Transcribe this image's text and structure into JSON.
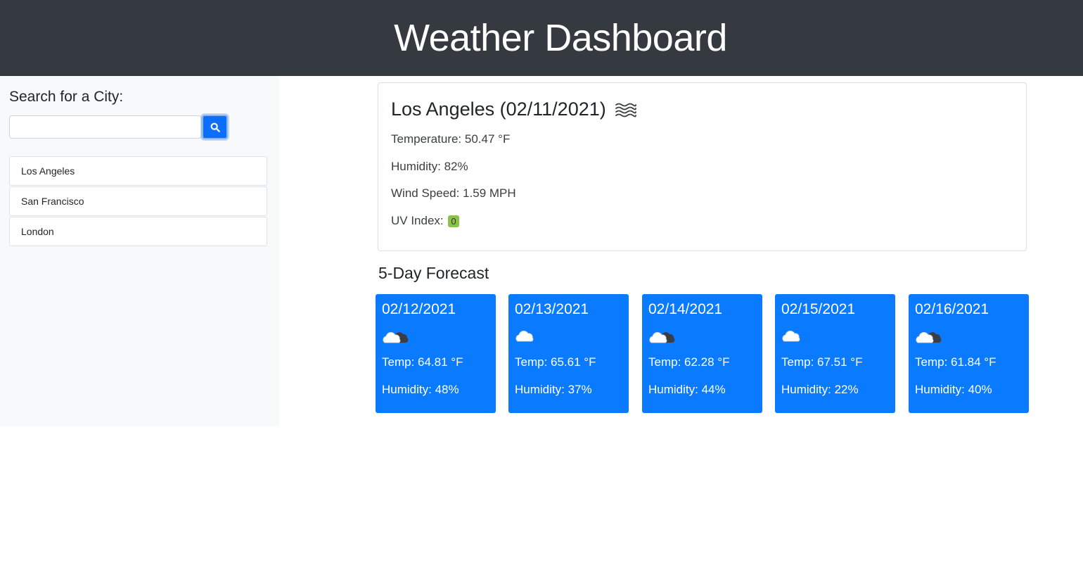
{
  "header": {
    "title": "Weather Dashboard"
  },
  "sidebar": {
    "search_label": "Search for a City:",
    "search_value": "",
    "search_placeholder": "",
    "search_button_icon": "search-icon",
    "history": [
      "Los Angeles",
      "San Francisco",
      "London"
    ]
  },
  "current": {
    "title": "Los Angeles (02/11/2021)",
    "icon": "mist-icon",
    "temperature": "Temperature: 50.47 °F",
    "humidity": "Humidity: 82%",
    "wind": "Wind Speed: 1.59 MPH",
    "uv_label": "UV Index:",
    "uv_value": "0",
    "uv_color": "#8bc34a"
  },
  "forecast": {
    "title": "5-Day Forecast",
    "card_color": "#0a7bff",
    "days": [
      {
        "date": "02/12/2021",
        "icon": "broken-clouds-icon",
        "temp": "Temp: 64.81 °F",
        "humidity": "Humidity: 48%"
      },
      {
        "date": "02/13/2021",
        "icon": "cloud-icon",
        "temp": "Temp: 65.61 °F",
        "humidity": "Humidity: 37%"
      },
      {
        "date": "02/14/2021",
        "icon": "broken-clouds-icon",
        "temp": "Temp: 62.28 °F",
        "humidity": "Humidity: 44%"
      },
      {
        "date": "02/15/2021",
        "icon": "cloud-icon",
        "temp": "Temp: 67.51 °F",
        "humidity": "Humidity: 22%"
      },
      {
        "date": "02/16/2021",
        "icon": "broken-clouds-icon",
        "temp": "Temp: 61.84 °F",
        "humidity": "Humidity: 40%"
      }
    ]
  }
}
